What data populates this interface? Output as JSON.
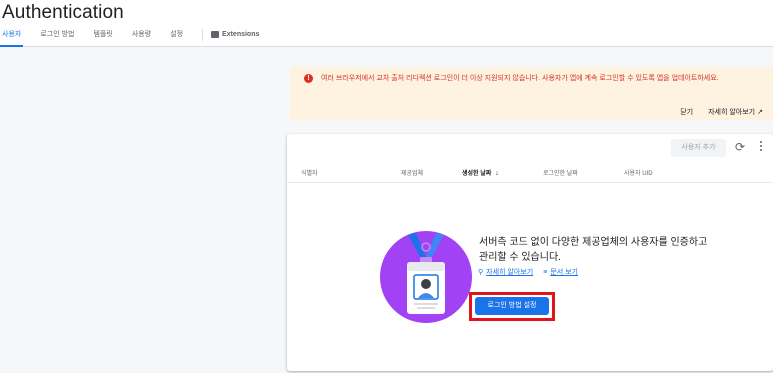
{
  "app": {
    "title": "Authentication"
  },
  "tabs": [
    {
      "label": "사용자",
      "active": true
    },
    {
      "label": "로그인 방법"
    },
    {
      "label": "템플릿"
    },
    {
      "label": "사용량"
    },
    {
      "label": "설정"
    },
    {
      "label": "Extensions",
      "icon": "extensions-icon"
    }
  ],
  "banner": {
    "icon": "error-icon",
    "text": "여러 브라우저에서 교차 출처 리디렉션 로그인이 더 이상 지원되지 않습니다. 사용자가 앱에 계속 로그인할 수 있도록 앱을 업데이트하세요.",
    "dismiss_label": "닫기",
    "learn_more_label": "자세히 알아보기",
    "external_icon": "open-in-new-icon",
    "text_color": "#d93025",
    "background_color": "#fef2e1"
  },
  "users_card": {
    "add_user_label": "사용자 추가",
    "refresh_icon": "refresh-icon",
    "more_icon": "more-vert-icon",
    "columns": [
      "식별자",
      "제공업체",
      "생성한 날짜",
      "로그인한 날짜",
      "사용자 UID"
    ],
    "sort_column": "생성한 날짜",
    "sort_icon": "arrow-downward-icon",
    "empty_state": {
      "message": "서버측 코드 없이 다양한 제공업체의 사용자를 인증하고 관리할 수 있습니다.",
      "learn_more_label": "자세히 알아보기",
      "docs_label": "문서 보기",
      "primary_button_label": "로그인 방법 설정",
      "illustration": "id-badge-illustration"
    }
  },
  "colors": {
    "accent": "#1a73e8",
    "highlight_box": "#e2131b"
  }
}
